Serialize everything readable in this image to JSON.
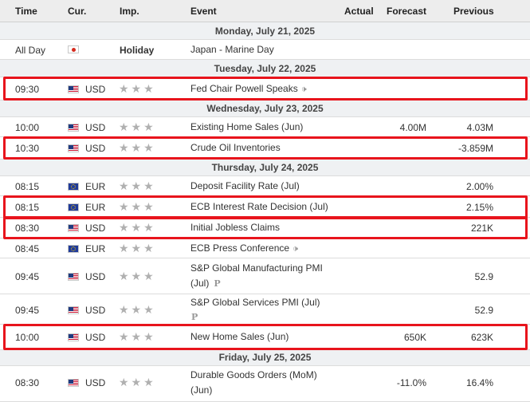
{
  "header": {
    "time": "Time",
    "currency": "Cur.",
    "importance": "Imp.",
    "event": "Event",
    "actual": "Actual",
    "forecast": "Forecast",
    "previous": "Previous"
  },
  "days": {
    "mon": "Monday, July 21, 2025",
    "tue": "Tuesday, July 22, 2025",
    "wed": "Wednesday, July 23, 2025",
    "thu": "Thursday, July 24, 2025",
    "fri": "Friday, July 25, 2025"
  },
  "importance_stars": "★★★",
  "holiday_label": "Holiday",
  "events": [
    {
      "time": "All Day",
      "flag": "japan-flag",
      "currency": "",
      "event": "Japan - Marine Day",
      "actual": "",
      "forecast": "",
      "previous": ""
    },
    {
      "time": "09:30",
      "flag": "us-flag",
      "currency": "USD",
      "event": "Fed Chair Powell Speaks",
      "actual": "",
      "forecast": "",
      "previous": ""
    },
    {
      "time": "10:00",
      "flag": "us-flag",
      "currency": "USD",
      "event": "Existing Home Sales (Jun)",
      "actual": "",
      "forecast": "4.00M",
      "previous": "4.03M"
    },
    {
      "time": "10:30",
      "flag": "us-flag",
      "currency": "USD",
      "event": "Crude Oil Inventories",
      "actual": "",
      "forecast": "",
      "previous": "-3.859M"
    },
    {
      "time": "08:15",
      "flag": "eu-flag",
      "currency": "EUR",
      "event": "Deposit Facility Rate (Jul)",
      "actual": "",
      "forecast": "",
      "previous": "2.00%"
    },
    {
      "time": "08:15",
      "flag": "eu-flag",
      "currency": "EUR",
      "event": "ECB Interest Rate Decision (Jul)",
      "actual": "",
      "forecast": "",
      "previous": "2.15%"
    },
    {
      "time": "08:30",
      "flag": "us-flag",
      "currency": "USD",
      "event": "Initial Jobless Claims",
      "actual": "",
      "forecast": "",
      "previous": "221K"
    },
    {
      "time": "08:45",
      "flag": "eu-flag",
      "currency": "EUR",
      "event": "ECB Press Conference",
      "actual": "",
      "forecast": "",
      "previous": ""
    },
    {
      "time": "09:45",
      "flag": "us-flag",
      "currency": "USD",
      "event": "S&P Global Manufacturing PMI",
      "event_line2": "(Jul)",
      "actual": "",
      "forecast": "",
      "previous": "52.9"
    },
    {
      "time": "09:45",
      "flag": "us-flag",
      "currency": "USD",
      "event": "S&P Global Services PMI (Jul)",
      "actual": "",
      "forecast": "",
      "previous": "52.9"
    },
    {
      "time": "10:00",
      "flag": "us-flag",
      "currency": "USD",
      "event": "New Home Sales (Jun)",
      "actual": "",
      "forecast": "650K",
      "previous": "623K"
    },
    {
      "time": "08:30",
      "flag": "us-flag",
      "currency": "USD",
      "event": "Durable Goods Orders (MoM)",
      "event_line2": "(Jun)",
      "actual": "",
      "forecast": "-11.0%",
      "previous": "16.4%"
    }
  ],
  "icons": {
    "speaker": "speaker-icon",
    "preliminary": "preliminary-icon",
    "preliminary_glyph": "P"
  },
  "colors": {
    "highlight": "#e8141c",
    "header_bg": "#ededed",
    "day_bg": "#eff1f3",
    "stars": "#b0b0b0"
  }
}
